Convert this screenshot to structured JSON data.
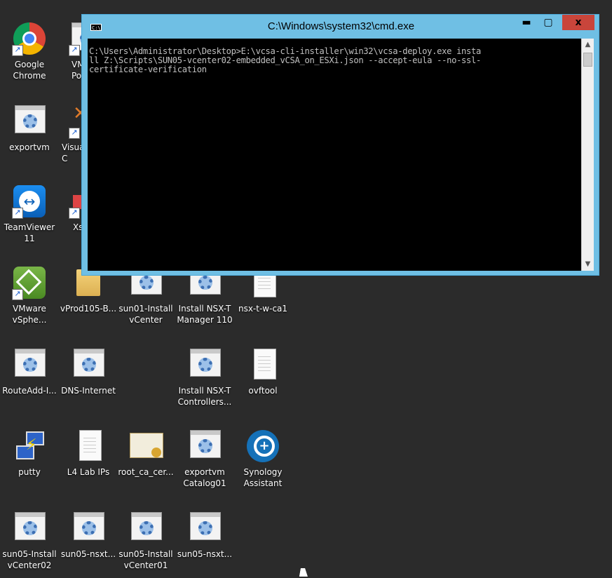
{
  "desktop": {
    "icons": {
      "chrome": {
        "label": "Google\nChrome",
        "icon": "chrome-icon"
      },
      "vm_partial": {
        "label": "VM\nPo",
        "icon": "script-icon"
      },
      "exportvm": {
        "label": "exportvm",
        "icon": "script-icon"
      },
      "visual_partial": {
        "label": "Visua\nC",
        "icon": "visual-studio-icon"
      },
      "teamviewer": {
        "label": "TeamViewer\n11",
        "icon": "teamviewer-icon"
      },
      "xs_partial": {
        "label": "Xs",
        "icon": "app-icon"
      },
      "vmware": {
        "label": "VMware\nvSphe...",
        "icon": "vmware-icon"
      },
      "vprod": {
        "label": "vProd105-B...",
        "icon": "folder-icon"
      },
      "sun01_install": {
        "label": "sun01-Install\nvCenter",
        "icon": "script-icon"
      },
      "install_nsx_mgr": {
        "label": "Install NSX-T\nManager 110",
        "icon": "script-icon"
      },
      "nsx_ca": {
        "label": "nsx-t-w-ca1",
        "icon": "document-icon"
      },
      "routeadd": {
        "label": "RouteAdd-I...",
        "icon": "script-icon"
      },
      "dns_internet": {
        "label": "DNS-Internet",
        "icon": "script-icon"
      },
      "install_nsx_ctrl": {
        "label": "Install NSX-T\nControllers...",
        "icon": "script-icon"
      },
      "ovftool": {
        "label": "ovftool",
        "icon": "document-icon"
      },
      "putty": {
        "label": "putty",
        "icon": "putty-icon"
      },
      "l4_lab": {
        "label": "L4 Lab IPs",
        "icon": "document-icon"
      },
      "root_ca": {
        "label": "root_ca_cer...",
        "icon": "certificate-icon"
      },
      "exportvm_catalog": {
        "label": "exportvm\nCatalog01",
        "icon": "script-icon"
      },
      "synology": {
        "label": "Synology\nAssistant",
        "icon": "synology-icon"
      },
      "sun05_install02": {
        "label": "sun05-Install\nvCenter02",
        "icon": "script-icon"
      },
      "sun05_nsxt1": {
        "label": "sun05-nsxt...",
        "icon": "script-icon"
      },
      "sun05_install01": {
        "label": "sun05-Install\nvCenter01",
        "icon": "script-icon"
      },
      "sun05_nsxt2": {
        "label": "sun05-nsxt...",
        "icon": "script-icon"
      }
    }
  },
  "cmd_window": {
    "title": "C:\\Windows\\system32\\cmd.exe",
    "sys_icon_text": "C:\\",
    "buttons": {
      "minimize": "▬",
      "maximize": "▢",
      "close": "x"
    },
    "console_text": "C:\\Users\\Administrator\\Desktop>E:\\vcsa-cli-installer\\win32\\vcsa-deploy.exe insta\nll Z:\\Scripts\\SUN05-vcenter02-embedded_vCSA_on_ESXi.json --accept-eula --no-ssl-\ncertificate-verification",
    "scroll_up": "▲",
    "scroll_down": "▼"
  },
  "colors": {
    "desktop_bg": "#2b2b2b",
    "titlebar": "#6fbfe4",
    "close_button": "#c9453b",
    "console_bg": "#000000",
    "console_fg": "#c0c0c0"
  }
}
